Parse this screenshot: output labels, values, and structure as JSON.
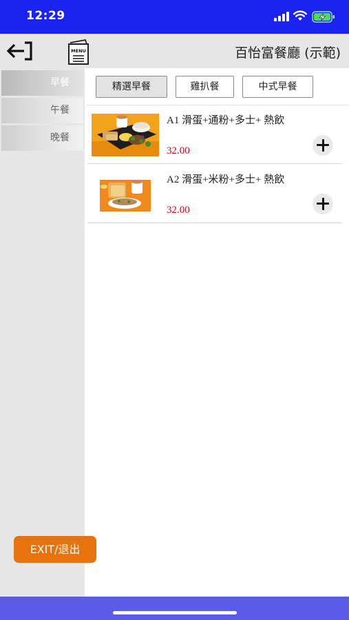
{
  "status_bar": {
    "time": "12:29",
    "icons": [
      "signal-icon",
      "wifi-icon",
      "battery-charging-icon"
    ],
    "background_color": "#1c23f0"
  },
  "header": {
    "title": "百怡富餐廳 (示範)",
    "menu_icon_label": "MENU",
    "icons": [
      "back-exit-icon",
      "menu-book-icon"
    ]
  },
  "sidebar": {
    "items": [
      {
        "label": "早餐",
        "active": true
      },
      {
        "label": "午餐",
        "active": false
      },
      {
        "label": "晚餐",
        "active": false
      }
    ]
  },
  "tabs": [
    {
      "label": "精選早餐",
      "active": true
    },
    {
      "label": "雞扒餐",
      "active": false
    },
    {
      "label": "中式早餐",
      "active": false
    }
  ],
  "products": [
    {
      "name": "A1 滑蛋+通粉+多士+ 熱飲",
      "price": "32.00",
      "icon": "add-icon"
    },
    {
      "name": "A2 滑蛋+米粉+多士+ 熱飲",
      "price": "32.00",
      "icon": "add-icon"
    }
  ],
  "exit_button": {
    "label": "EXIT/退出",
    "color": "#e8730c"
  },
  "colors": {
    "price": "#d0021b",
    "bottom_bar": "#5b5bea",
    "sidebar_bg": "#e6e6e6"
  }
}
